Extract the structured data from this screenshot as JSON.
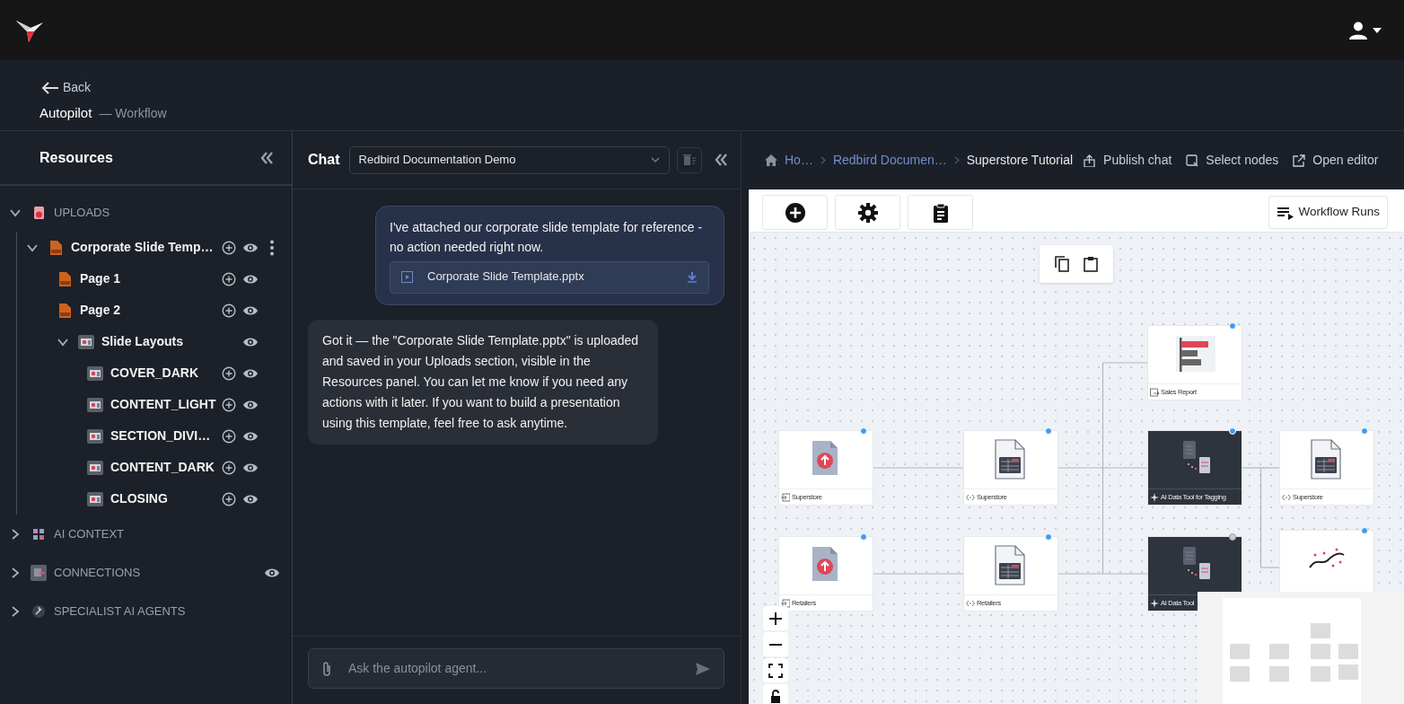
{
  "header": {
    "back": "Back",
    "title": "Autopilot",
    "subtitle": "— Workflow"
  },
  "resources": {
    "title": "Resources",
    "tree": [
      {
        "label": "UPLOADS",
        "kind": "uploads",
        "expanded": true,
        "children": [
          {
            "label": "Corporate Slide Temp…",
            "kind": "ppt",
            "expanded": true,
            "add": true,
            "view": true,
            "menu": true,
            "children": [
              {
                "label": "Page 1",
                "kind": "ppt",
                "add": true,
                "view": true
              },
              {
                "label": "Page 2",
                "kind": "ppt",
                "add": true,
                "view": true
              },
              {
                "label": "Slide Layouts",
                "kind": "layout",
                "expanded": true,
                "view": true,
                "children": [
                  {
                    "label": "COVER_DARK",
                    "kind": "layout",
                    "add": true,
                    "view": true
                  },
                  {
                    "label": "CONTENT_LIGHT",
                    "kind": "layout",
                    "add": true,
                    "view": true
                  },
                  {
                    "label": "SECTION_DIVI…",
                    "kind": "layout",
                    "add": true,
                    "view": true
                  },
                  {
                    "label": "CONTENT_DARK",
                    "kind": "layout",
                    "add": true,
                    "view": true
                  },
                  {
                    "label": "CLOSING",
                    "kind": "layout",
                    "add": true,
                    "view": true
                  }
                ]
              }
            ]
          }
        ]
      },
      {
        "label": "AI CONTEXT",
        "kind": "context",
        "expanded": false
      },
      {
        "label": "CONNECTIONS",
        "kind": "connections",
        "expanded": false,
        "view": true
      },
      {
        "label": "SPECIALIST AI AGENTS",
        "kind": "agents",
        "expanded": false
      }
    ]
  },
  "chat": {
    "title": "Chat",
    "conversation": "Redbird Documentation Demo",
    "messages": [
      {
        "kind": "sent",
        "text": "I've attached our corporate slide template for reference - no action needed right now.",
        "attachment": "Corporate Slide Template.pptx"
      },
      {
        "kind": "received",
        "text": "Got it — the \"Corporate Slide Template.pptx\" is uploaded and saved in your Uploads section, visible in the Resources panel. You can let me know if you need any actions with it later. If you want to build a presentation using this template, feel free to ask anytime."
      }
    ],
    "input": {
      "placeholder": "Ask the autopilot agent..."
    }
  },
  "breadcrumbs": [
    {
      "label": "Ho…",
      "kind": "link"
    },
    {
      "label": "Redbird Documen…",
      "kind": "link"
    },
    {
      "label": "Superstore Tutorial",
      "kind": "current"
    }
  ],
  "actions": [
    {
      "label": "Publish chat",
      "kind": "publish"
    },
    {
      "label": "Select nodes",
      "kind": "select"
    },
    {
      "label": "Open editor",
      "kind": "open"
    }
  ],
  "canvas": {
    "runs_button": "Workflow Runs",
    "nodes": [
      {
        "kind": "upload",
        "label": "Superstore",
        "verified": true
      },
      {
        "kind": "transform",
        "label": "Superstore",
        "verified": true
      },
      {
        "kind": "report",
        "label": "Sales Report",
        "verified": true
      },
      {
        "kind": "ai",
        "label": "AI Data Tool for Tagging",
        "verified": true
      },
      {
        "kind": "transform",
        "label": "Superstore",
        "verified": true
      },
      {
        "kind": "upload",
        "label": "Retailers",
        "verified": true
      },
      {
        "kind": "transform",
        "label": "Retailers",
        "verified": true
      },
      {
        "kind": "ai",
        "label": "AI Data Tool",
        "verified": false
      },
      {
        "kind": "chart",
        "verified": true
      }
    ]
  }
}
